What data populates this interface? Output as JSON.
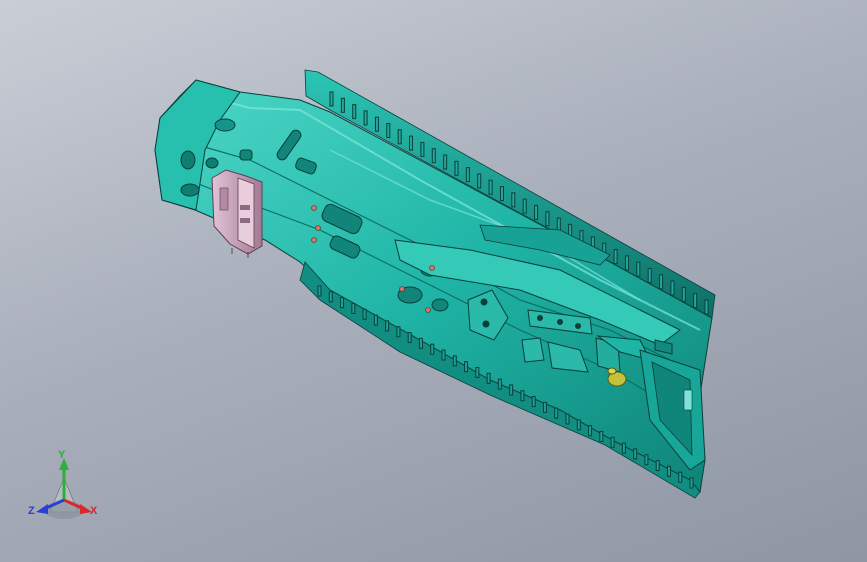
{
  "viewport": {
    "background_top": "#c9ced6",
    "background_bottom": "#8f96a4"
  },
  "model": {
    "body_color": "#1fb5a6",
    "body_light": "#4fd8c8",
    "body_dark": "#0d6e66",
    "edge_color": "#0a3f3a",
    "bracket_color": "#c9a0b8",
    "bracket_dark": "#8e6a82"
  },
  "triad": {
    "x_label": "X",
    "y_label": "Y",
    "z_label": "Z",
    "x_color": "#d8282a",
    "y_color": "#2fae3a",
    "z_color": "#2a3fd8"
  }
}
